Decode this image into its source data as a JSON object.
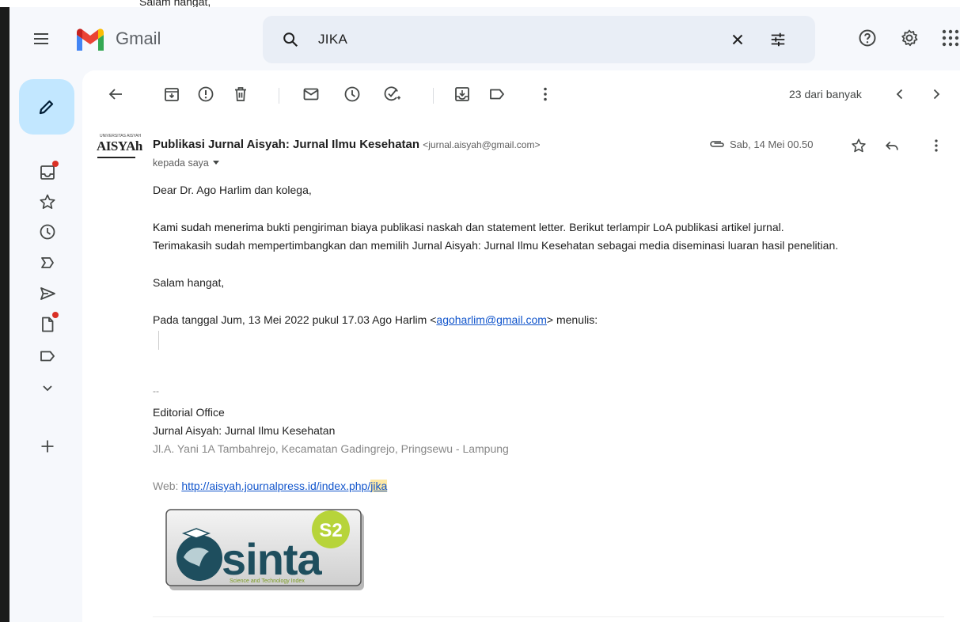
{
  "overflow_text": "Salam hangat,",
  "app": {
    "name": "Gmail"
  },
  "search": {
    "query": "JIKA"
  },
  "pager": {
    "text": "23 dari banyak"
  },
  "message": {
    "sender_name": "Publikasi Jurnal Aisyah: Jurnal Ilmu Kesehatan",
    "sender_email": "<jurnal.aisyah@gmail.com>",
    "recipient": "kepada saya",
    "date": "Sab, 14 Mei 00.50",
    "avatar_text": "AISYAh",
    "avatar_small": "UNIVERSITAS AISYAH",
    "greeting": "Dear Dr. Ago Harlim dan kolega,",
    "p1_bold": "Kami sudah menerima",
    "p1_rest": " bukti pengiriman biaya publikasi naskah dan statement letter. Berikut terlampir LoA publikasi artikel jurnal.",
    "p2": "Terimakasih sudah mempertimbangkan dan memilih Jurnal Aisyah: Jurnal Ilmu Kesehatan sebagai media diseminasi luaran hasil penelitian.",
    "closing": "Salam hangat,",
    "quote_prefix": "Pada tanggal Jum, 13 Mei 2022 pukul 17.03 Ago Harlim <",
    "quote_email": "agoharlim@gmail.com",
    "quote_suffix": "> menulis:",
    "sig_dash": "--",
    "sig_office": "Editorial Office",
    "sig_journal": "Jurnal Aisyah: Jurnal Ilmu Kesehatan",
    "sig_address": "Jl.A. Yani 1A Tambahrejo, Kecamatan Gadingrejo, Pringsewu - Lampung",
    "web_label": "Web: ",
    "web_url": "http://aisyah.journalpress.id/index.php/",
    "web_url_hl": "jika"
  },
  "sinta": {
    "word": "sinta",
    "badge": "S2",
    "tagline": "Science and Technology Index"
  },
  "icons": [
    "menu-icon",
    "search-icon",
    "close-icon",
    "tune-icon",
    "help-icon",
    "gear-icon",
    "apps-icon",
    "pencil-icon",
    "inbox-icon",
    "star-icon",
    "clock-icon",
    "important-icon",
    "send-icon",
    "draft-icon",
    "label-icon",
    "chevron-down-icon",
    "plus-icon",
    "back-icon",
    "archive-icon",
    "report-spam-icon",
    "delete-icon",
    "mark-unread-icon",
    "snooze-icon",
    "add-task-icon",
    "move-to-icon",
    "label-as-icon",
    "more-vert-icon",
    "chevron-left-icon",
    "chevron-right-icon",
    "attachment-icon",
    "reply-icon"
  ],
  "colors": {
    "compose_bg": "#c2e7ff",
    "search_bg": "#e9eef6",
    "link": "#1155cc",
    "badge_dot": "#d93025",
    "highlight": "#fce8a6",
    "app_bg": "#f6f8fc"
  }
}
